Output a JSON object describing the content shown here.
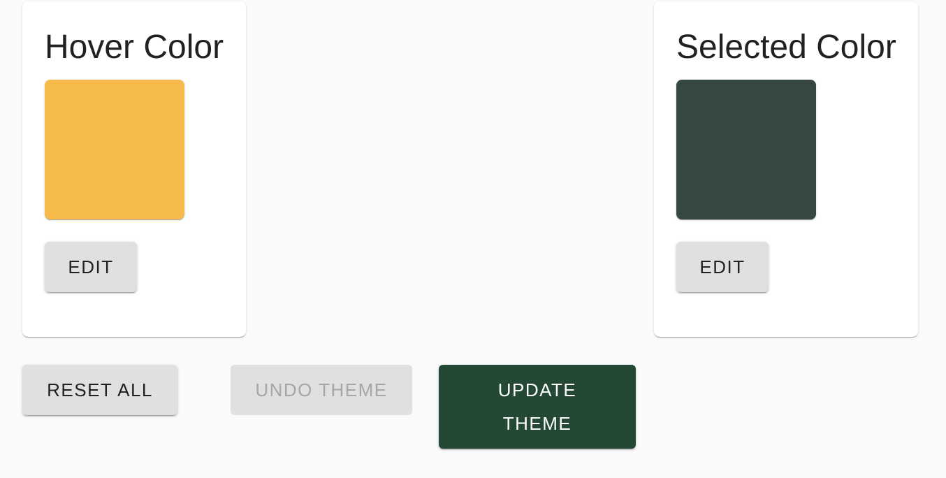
{
  "cards": [
    {
      "title": "Hover Color",
      "swatch_color": "#f6ba4a",
      "edit_label": "EDIT"
    },
    {
      "title": "Selected Color",
      "swatch_color": "#374841",
      "edit_label": "EDIT"
    }
  ],
  "actions": {
    "reset_all_label": "RESET ALL",
    "undo_theme_label": "UNDO THEME",
    "update_theme_label": "UPDATE THEME"
  },
  "colors": {
    "primary": "#234935",
    "button_default": "#e0e0e0"
  }
}
